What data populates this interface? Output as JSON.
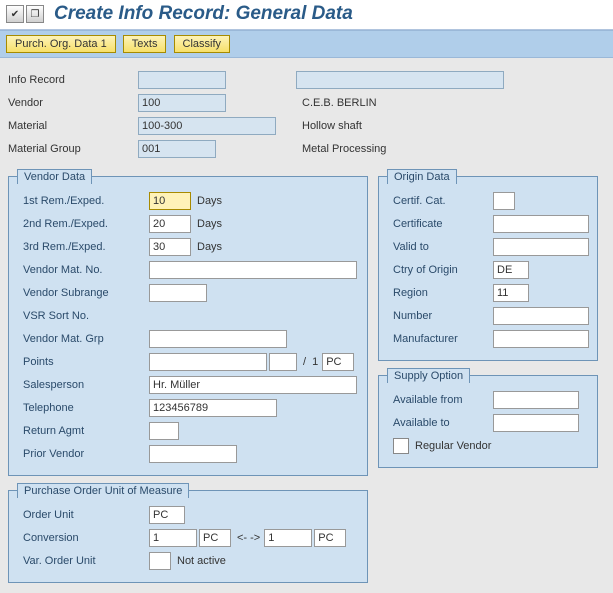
{
  "title": "Create Info Record: General Data",
  "toolbar": {
    "purch_org_data1": "Purch. Org. Data 1",
    "texts": "Texts",
    "classify": "Classify"
  },
  "header": {
    "info_record_label": "Info Record",
    "info_record_value": "",
    "info_record_desc_value": "",
    "vendor_label": "Vendor",
    "vendor_value": "100",
    "vendor_desc": "C.E.B. BERLIN",
    "material_label": "Material",
    "material_value": "100-300",
    "material_desc": "Hollow shaft",
    "material_group_label": "Material Group",
    "material_group_value": "001",
    "material_group_desc": "Metal Processing"
  },
  "vendor_data": {
    "legend": "Vendor Data",
    "rem1_label": "1st Rem./Exped.",
    "rem1_value": "10",
    "rem1_unit": "Days",
    "rem2_label": "2nd Rem./Exped.",
    "rem2_value": "20",
    "rem2_unit": "Days",
    "rem3_label": "3rd Rem./Exped.",
    "rem3_value": "30",
    "rem3_unit": "Days",
    "vendor_mat_no_label": "Vendor Mat. No.",
    "vendor_mat_no_value": "",
    "vendor_subrange_label": "Vendor Subrange",
    "vendor_subrange_value": "",
    "vsr_sort_label": "VSR Sort No.",
    "vsr_sort_value": "",
    "vendor_mat_grp_label": "Vendor Mat. Grp",
    "vendor_mat_grp_value": "",
    "points_label": "Points",
    "points_value": "",
    "points_sep": "/",
    "points_per": "1",
    "points_unit": "PC",
    "salesperson_label": "Salesperson",
    "salesperson_value": "Hr. Müller",
    "telephone_label": "Telephone",
    "telephone_value": "123456789",
    "return_agmt_label": "Return Agmt",
    "return_agmt_value": "",
    "prior_vendor_label": "Prior Vendor",
    "prior_vendor_value": ""
  },
  "origin_data": {
    "legend": "Origin Data",
    "certif_cat_label": "Certif. Cat.",
    "certif_cat_value": "",
    "certificate_label": "Certificate",
    "certificate_value": "",
    "valid_to_label": "Valid to",
    "valid_to_value": "",
    "ctry_origin_label": "Ctry of Origin",
    "ctry_origin_value": "DE",
    "region_label": "Region",
    "region_value": "11",
    "number_label": "Number",
    "number_value": "",
    "manufacturer_label": "Manufacturer",
    "manufacturer_value": ""
  },
  "supply_option": {
    "legend": "Supply Option",
    "available_from_label": "Available from",
    "available_from_value": "",
    "available_to_label": "Available to",
    "available_to_value": "",
    "regular_vendor_label": "Regular Vendor"
  },
  "po_unit": {
    "legend": "Purchase Order Unit of Measure",
    "order_unit_label": "Order Unit",
    "order_unit_value": "PC",
    "conversion_label": "Conversion",
    "conversion_left": "1",
    "conversion_left_unit": "PC",
    "conversion_arrow": "<- ->",
    "conversion_right": "1",
    "conversion_right_unit": "PC",
    "var_order_unit_label": "Var. Order Unit",
    "var_order_unit_value": "",
    "var_order_unit_desc": "Not active"
  }
}
